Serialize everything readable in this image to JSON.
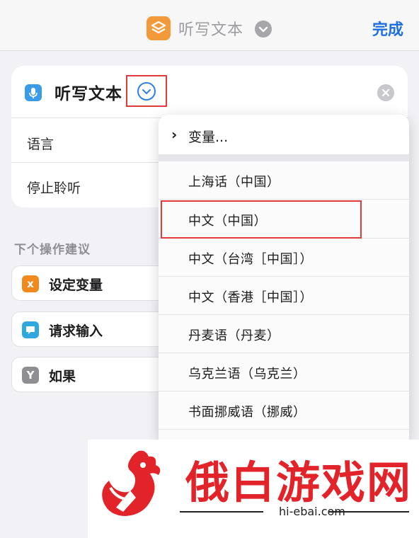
{
  "nav": {
    "title": "听写文本",
    "done_label": "完成"
  },
  "action_card": {
    "title": "听写文本",
    "rows": [
      {
        "label": "语言"
      },
      {
        "label": "停止聆听"
      }
    ]
  },
  "suggestions": {
    "heading": "下个操作建议",
    "items": [
      {
        "label": "设定变量",
        "icon": "variable-icon",
        "icon_glyph": "x",
        "color": "#f08a1e"
      },
      {
        "label": "请求输入",
        "icon": "chat-bubble-icon",
        "icon_glyph": "▪",
        "color": "#2fa8e0"
      },
      {
        "label": "如果",
        "icon": "branch-icon",
        "icon_glyph": "Y",
        "color": "#8e8e93"
      }
    ]
  },
  "language_menu": {
    "variable_label": "变量...",
    "options": [
      "上海话（中国）",
      "中文（中国）",
      "中文（台湾［中国］）",
      "中文（香港［中国］）",
      "丹麦语（丹麦）",
      "乌克兰语（乌克兰）",
      "书面挪威语（挪威）"
    ],
    "highlighted": "中文（中国）"
  },
  "watermark": {
    "text": "俄白游戏网",
    "url": "hi-ebai.com"
  },
  "colors": {
    "accent": "#1d6fe0",
    "highlight": "#e23a3a",
    "brand": "#e2242a"
  }
}
